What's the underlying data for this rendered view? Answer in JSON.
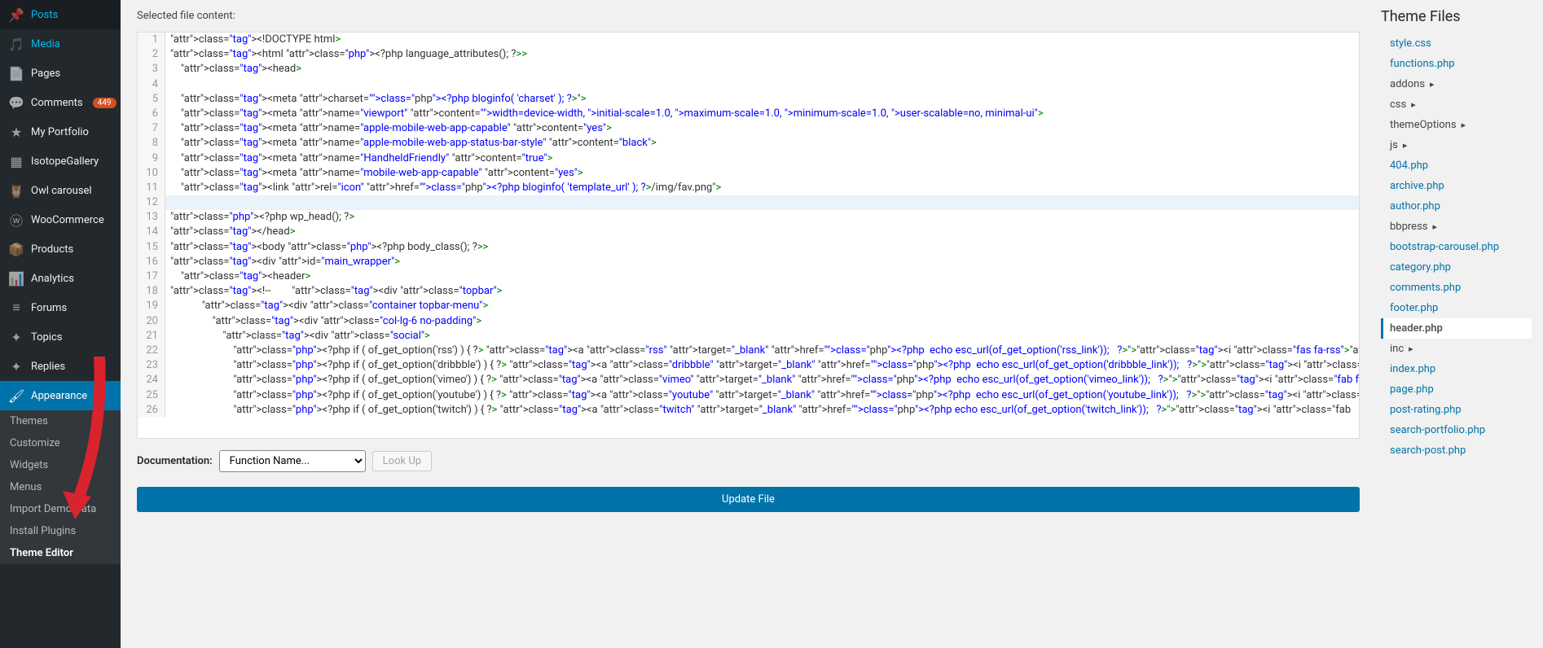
{
  "sidebar": {
    "items": [
      {
        "icon": "pin",
        "label": "Posts"
      },
      {
        "icon": "media",
        "label": "Media",
        "highlight": true
      },
      {
        "icon": "page",
        "label": "Pages"
      },
      {
        "icon": "comment",
        "label": "Comments",
        "badge": "449"
      },
      {
        "icon": "star",
        "label": "My Portfolio"
      },
      {
        "icon": "grid",
        "label": "IsotopeGallery"
      },
      {
        "icon": "owl",
        "label": "Owl carousel"
      },
      {
        "icon": "woo",
        "label": "WooCommerce"
      },
      {
        "icon": "product",
        "label": "Products"
      },
      {
        "icon": "chart",
        "label": "Analytics"
      },
      {
        "icon": "forum",
        "label": "Forums"
      },
      {
        "icon": "topic",
        "label": "Topics"
      },
      {
        "icon": "reply",
        "label": "Replies"
      },
      {
        "icon": "brush",
        "label": "Appearance",
        "active": true
      }
    ],
    "submenu": [
      {
        "label": "Themes"
      },
      {
        "label": "Customize"
      },
      {
        "label": "Widgets"
      },
      {
        "label": "Menus"
      },
      {
        "label": "Import Demo Data"
      },
      {
        "label": "Install Plugins"
      },
      {
        "label": "Theme Editor",
        "current": true
      }
    ]
  },
  "main": {
    "content_label": "Selected file content:",
    "code_lines": [
      {
        "n": 1,
        "t": "<!DOCTYPE html>"
      },
      {
        "n": 2,
        "t": "<html <?php language_attributes(); ?>>"
      },
      {
        "n": 3,
        "t": "    <head>"
      },
      {
        "n": 4,
        "t": ""
      },
      {
        "n": 5,
        "t": "    <meta charset=\"<?php bloginfo( 'charset' ); ?>\">"
      },
      {
        "n": 6,
        "t": "    <meta name=\"viewport\" content=\"width=device-width, initial-scale=1.0, maximum-scale=1.0, minimum-scale=1.0, user-scalable=no, minimal-ui\">"
      },
      {
        "n": 7,
        "t": "    <meta name=\"apple-mobile-web-app-capable\" content=\"yes\">"
      },
      {
        "n": 8,
        "t": "    <meta name=\"apple-mobile-web-app-status-bar-style\" content=\"black\">"
      },
      {
        "n": 9,
        "t": "    <meta name=\"HandheldFriendly\" content=\"true\">"
      },
      {
        "n": 10,
        "t": "    <meta name=\"mobile-web-app-capable\" content=\"yes\">"
      },
      {
        "n": 11,
        "t": "    <link rel=\"icon\" href=\"<?php bloginfo( 'template_url' ); ?>/img/fav.png\">"
      },
      {
        "n": 12,
        "t": "",
        "hl": true
      },
      {
        "n": 13,
        "t": "<?php wp_head(); ?>"
      },
      {
        "n": 14,
        "t": "</head>"
      },
      {
        "n": 15,
        "t": "<body <?php body_class(); ?>>"
      },
      {
        "n": 16,
        "t": "<div id=\"main_wrapper\">"
      },
      {
        "n": 17,
        "t": "    <header>"
      },
      {
        "n": 18,
        "t": "<!--        <div class=\"topbar\">"
      },
      {
        "n": 19,
        "t": "            <div class=\"container topbar-menu\">"
      },
      {
        "n": 20,
        "t": "                <div class=\"col-lg-6 no-padding\">"
      },
      {
        "n": 21,
        "t": "                    <div class=\"social\">"
      },
      {
        "n": 22,
        "t": "                        <?php if ( of_get_option('rss') ) { ?> <a class=\"rss\" target=\"_blank\" href=\"<?php  echo esc_url(of_get_option('rss_link'));   ?>\"><i class=\"fas fa-rss\"></i> </a><?php } ?>"
      },
      {
        "n": 23,
        "t": "                        <?php if ( of_get_option('dribbble') ) { ?> <a class=\"dribbble\" target=\"_blank\" href=\"<?php  echo esc_url(of_get_option('dribbble_link'));   ?>\"><i class=\"fab fa-dribbble\"></i> </a><?php } ?>"
      },
      {
        "n": 24,
        "t": "                        <?php if ( of_get_option('vimeo') ) { ?> <a class=\"vimeo\" target=\"_blank\" href=\"<?php  echo esc_url(of_get_option('vimeo_link'));   ?>\"><i class=\"fab fa-vimeo-v\"></i> </a><?php } ?>"
      },
      {
        "n": 25,
        "t": "                        <?php if ( of_get_option('youtube') ) { ?> <a class=\"youtube\" target=\"_blank\" href=\"<?php  echo esc_url(of_get_option('youtube_link'));   ?>\"><i class=\"fab fa-youtube\"></i> </a><?php } ?>"
      },
      {
        "n": 26,
        "t": "                        <?php if ( of_get_option('twitch') ) { ?> <a class=\"twitch\" target=\"_blank\" href=\"<?php echo esc_url(of_get_option('twitch_link'));   ?>\"><i class=\"fab"
      }
    ],
    "doc_label": "Documentation:",
    "select_placeholder": "Function Name...",
    "lookup_label": "Look Up",
    "update_label": "Update File"
  },
  "right": {
    "title": "Theme Files",
    "files": [
      {
        "label": "style.css"
      },
      {
        "label": "functions.php"
      },
      {
        "label": "addons",
        "folder": true
      },
      {
        "label": "css",
        "folder": true
      },
      {
        "label": "themeOptions",
        "folder": true
      },
      {
        "label": "js",
        "folder": true
      },
      {
        "label": "404.php"
      },
      {
        "label": "archive.php"
      },
      {
        "label": "author.php"
      },
      {
        "label": "bbpress",
        "folder": true
      },
      {
        "label": "bootstrap-carousel.php"
      },
      {
        "label": "category.php"
      },
      {
        "label": "comments.php"
      },
      {
        "label": "footer.php"
      },
      {
        "label": "header.php",
        "current": true
      },
      {
        "label": "inc",
        "folder": true
      },
      {
        "label": "index.php"
      },
      {
        "label": "page.php"
      },
      {
        "label": "post-rating.php"
      },
      {
        "label": "search-portfolio.php"
      },
      {
        "label": "search-post.php"
      }
    ]
  },
  "icons": {
    "pin": "📌",
    "media": "🎵",
    "page": "📄",
    "comment": "💬",
    "star": "★",
    "grid": "▦",
    "owl": "🦉",
    "woo": "ⓦ",
    "product": "📦",
    "chart": "📊",
    "forum": "≡",
    "topic": "✦",
    "reply": "✦",
    "brush": "🖌"
  }
}
